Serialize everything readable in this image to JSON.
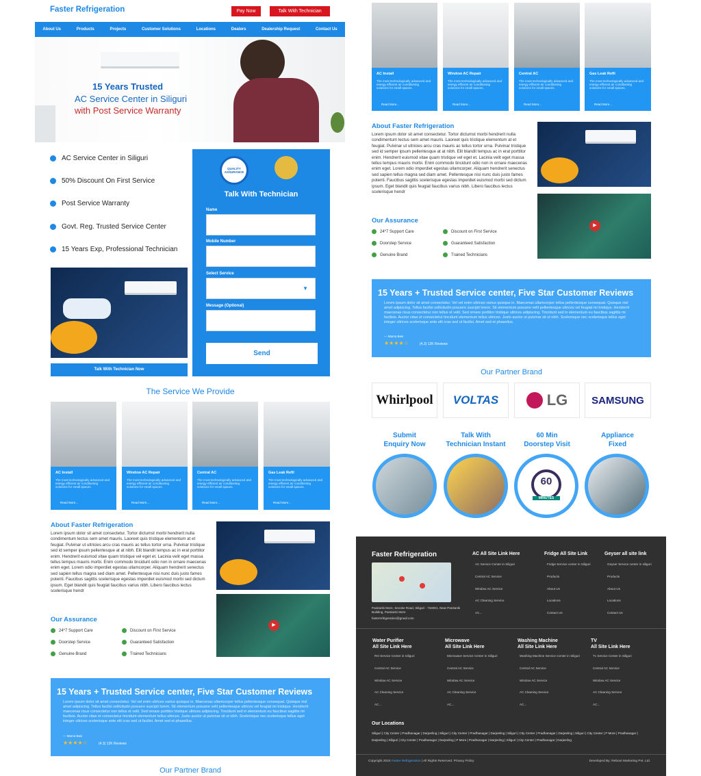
{
  "header": {
    "logo": "Faster Refrigeration",
    "pay_now": "Pay Now",
    "talk_btn": "Talk With Technician"
  },
  "nav": [
    "About Us",
    "Products",
    "Projects",
    "Customer Solutions",
    "Locations",
    "Dealers",
    "Dealership Request",
    "Contact Us"
  ],
  "hero": {
    "line1": "15 Years Trusted",
    "line2": "AC Service Center in Siliguri",
    "line3": "with Post Service Warranty"
  },
  "features": [
    "AC Service Center in Siliguri",
    "50% Discount On First Service",
    "Post Service Warranty",
    "Govt. Reg. Trusted Service Center",
    "15 Years Exp, Professional Technician"
  ],
  "talk_now_btn": "Talk With Technician Now",
  "form": {
    "badge": "QUALITY ASSURANCE",
    "title": "Talk With Technician",
    "name": "Name",
    "mobile": "Mobile Number",
    "service": "Select Service",
    "message": "Message (Optional)",
    "send": "Send"
  },
  "services": {
    "title": "The Service We Provide",
    "cards": [
      {
        "title": "AC Install",
        "desc": "The most technologically advanced and energy efficient air conditioning solutions for small spaces.",
        "more": "Read More..."
      },
      {
        "title": "Window AC Repair",
        "desc": "The most technologically advanced and energy efficient air conditioning solutions for small spaces.",
        "more": "Read More..."
      },
      {
        "title": "Central AC",
        "desc": "The most technologically advanced and energy efficient air conditioning solutions for small spaces.",
        "more": "Read More..."
      },
      {
        "title": "Gas Leak Refil",
        "desc": "The most technologically advanced and energy efficient air conditioning solutions for small spaces.",
        "more": "Read More..."
      }
    ]
  },
  "about": {
    "title": "About Faster Refrigeration",
    "text": "Lorem ipsum dolor sit amet consectetur. Tortor dictumst morbi hendrerit nulla condimentum lectus sem amet mauris. Laoreet quis tristique elementum at et feugiat. Pulvinar ut ultricies arcu cras mauris ac tellus tortor urna. Pulvinar tristique sed id semper ipsum pellentesque at at nibh. Elit blandit tempus ac in erat porttitor enim. Hendrerit euismod vitae quam tristique vel eget et. Lacinia velit eget massa tellus tempus mauris morbi. Enim commodo tincidunt odio non in ornare maecenas enim eget. Lorem odio imperdiet egestas ullamcorper. Aliquam hendrerit senectus sed sapien tellus magna sed diam amet. Pellentesque nisi nunc duis justo fames potenti. Faucibus sagittis scelerisque egestas imperdiet euismod morbi sed dictum ipsum. Eget blandit quis feugiat faucibus varius nibh. Libero faucibus lectus scelerisque hendr"
  },
  "assurance": {
    "title": "Our Assurance",
    "items": [
      "24*7 Support Care",
      "Discount on First Service",
      "Doorstep Service",
      "Guaranteed Satisfaction",
      "Genuine Brand",
      "Trained Technicians"
    ]
  },
  "reviews": {
    "title": "15 Years + Trusted Service center, Five Star Customer Reviews",
    "text": "Lorem ipsum dolor sit amet consectetur. Vel vel enim ultrices varius quisque in. Maecenas ullamcorper tellus pellentesque consequat. Quisque nisl amet adipiscing. Tellus facilisi sollicitudin posuere suscipit lorem. Sit elementum posuere velit pellentesque ultrices vel feugiat mi tristique. Hendrerit maecenas risus consectetur non tellus et velit. Sed ornare porttitor tristique ultrices adipiscing. Tincidunt sed in elementum eu faucibus sagittis mi facilisis. Auctor vitae et consectetur tincidunt elementum tellus ultrices. Justo auctor ut pulvinar sit ut nibh. Scelerisque nec scelerisque tellus eget integer ultrices scelerisque ante elit cras sed ut facilisi. Amet sed et phasellus.",
    "author": "— Mama Basi",
    "rating_text": "(4.3) 12K Reviews",
    "rating": 4.3
  },
  "partners": {
    "title": "Our Partner Brand",
    "brands": [
      "Whirlpool",
      "VOLTAS",
      "LG",
      "SAMSUNG"
    ]
  },
  "steps": [
    {
      "l1": "Submit",
      "l2": "Enquiry Now"
    },
    {
      "l1": "Talk With",
      "l2": "Technician Instant"
    },
    {
      "l1": "60 Min",
      "l2": "Doorstep Visit"
    },
    {
      "l1": "Appliance",
      "l2": "Fixed"
    }
  ],
  "clock": {
    "num": "60",
    "unit": "MINUTES"
  },
  "footer": {
    "logo": "Faster Refrigeration",
    "address": "Panitanki More, Sevoke Road, Siliguri - 734001, Near Panitanki Building, Panitanki More",
    "email": "fasterrefrigeration@gmail.com",
    "col1": {
      "title": "AC All Site Link Here",
      "links": [
        "AC Service Center in Siliguri",
        "Central AC Service",
        "Window AC Service",
        "AC Cleaning Service",
        "AC..."
      ]
    },
    "col2": {
      "title": "Fridge All Site Link",
      "links": [
        "Fridge Service center in Siliguri",
        "Products",
        "About Us",
        "Locations",
        "Contact Us"
      ]
    },
    "col3": {
      "title": "Geyser all site link",
      "links": [
        "Geyser Service center in siliguri",
        "Products",
        "About Us",
        "Locations",
        "Contact Us"
      ]
    },
    "row2": [
      {
        "t1": "Water Purifier",
        "t2": "All Site Link Here",
        "links": [
          "RO Service Center in Siliguri",
          "Central AC Service",
          "Window AC Service",
          "AC Cleaning Service",
          "AC..."
        ]
      },
      {
        "t1": "Microwave",
        "t2": "All Site Link Here",
        "links": [
          "Microwave Service Center in Siliguri",
          "Central AC Service",
          "Window AC Service",
          "AC Cleaning Service",
          "AC..."
        ]
      },
      {
        "t1": "Washing Machine",
        "t2": "All Site Link Here",
        "links": [
          "Washing Machine Service Center in Siliguri",
          "Central AC Service",
          "Window AC Service",
          "AC Cleaning Service",
          "AC..."
        ]
      },
      {
        "t1": "TV",
        "t2": "All Site Link Here",
        "links": [
          "Tv Service Center in Siliguri",
          "Central AC Service",
          "Window AC Service",
          "AC Cleaning Service",
          "AC..."
        ]
      }
    ],
    "locations_title": "Our Locations",
    "locations": "Siliguri | City Center | Pradhanagar | Darjeeling | Siliguri | City Center | Pradhanagar | Darjeeling | Siliguri | City Center | Pradhanagar | Darjeeling | Siliguri | City Center | P More | Pradhanagar | Darjeeling | Siliguri | City Center | Pradhanagar | Darjeeling | P More | Pradhanagar | Darjeeling | Siliguri | City Center | Pradhanagar | Darjeeling",
    "copyright_pre": "Copyright 2024",
    "copyright_brand": "Faster Refrigeration",
    "copyright_post": "| All Rights Reserved. Privacy Policy",
    "dev": "Developed By: Reboot Marketing Pvt. Ltd."
  }
}
